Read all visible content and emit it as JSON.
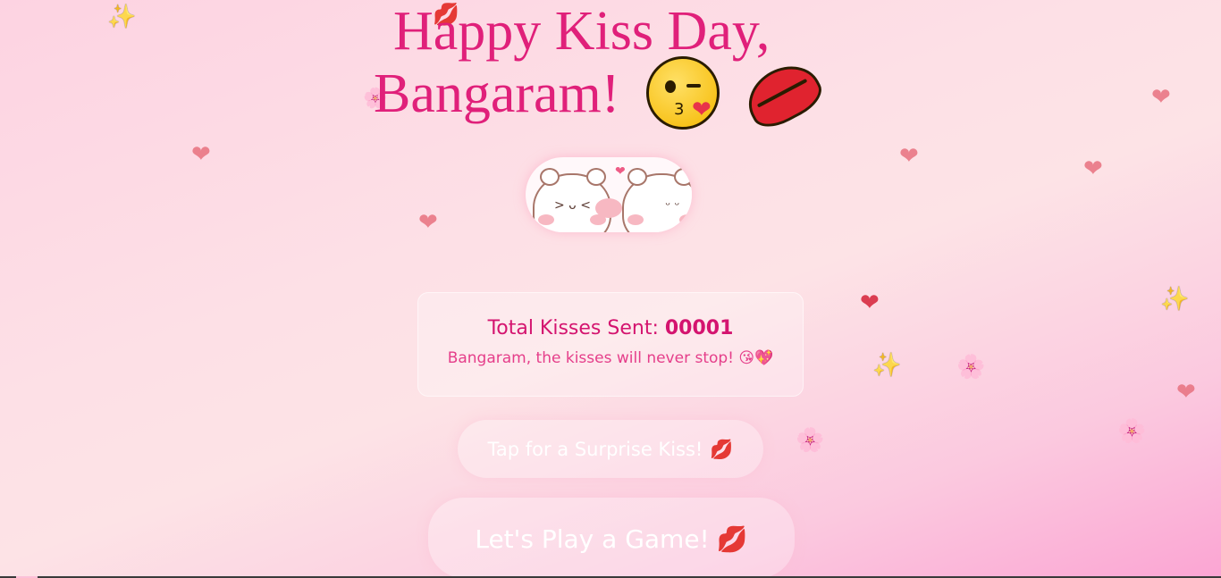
{
  "title": {
    "line1": "Happy Kiss Day,",
    "line2": "Bangaram!",
    "emoji_face": "kissing-face-wink-heart-icon",
    "emoji_lips": "kiss-mark-icon"
  },
  "bear_image": {
    "icon": "kissing-bears-icon"
  },
  "counter": {
    "label": "Total Kisses Sent: ",
    "value": "00001",
    "message": "Bangaram, the kisses will never stop! 😘💖"
  },
  "buttons": {
    "surprise_label": "Tap for a Surprise Kiss!",
    "game_label": "Let's Play a Game!",
    "icon": "kiss-mark-icon"
  },
  "floaters": [
    {
      "glyph": "✨",
      "icon": "sparkles-icon"
    },
    {
      "glyph": "💋",
      "icon": "kiss-mark-icon"
    },
    {
      "glyph": "❤",
      "icon": "heart-icon"
    },
    {
      "glyph": "🌸",
      "icon": "flower-icon"
    }
  ],
  "colors": {
    "title": "#e0207a",
    "counter_text": "#d4146f",
    "message_text": "#e53e8a",
    "button_text": "#ffffff",
    "bg_start": "#fdd3e2",
    "bg_end": "#fba5d3"
  }
}
